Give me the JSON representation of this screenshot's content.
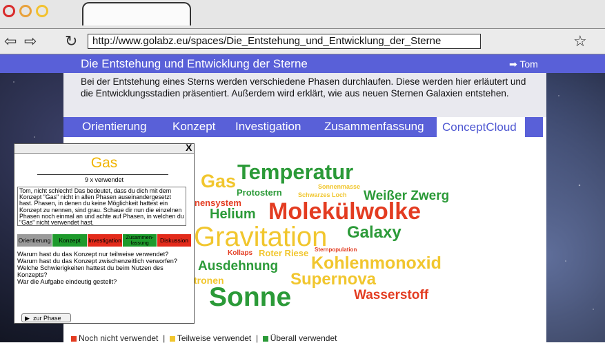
{
  "browser": {
    "url": "http://www.golabz.eu/spaces/Die_Entstehung_und_Entwicklung_der_Sterne"
  },
  "header": {
    "title": "Die Entstehung und Entwicklung der Sterne",
    "user": "Tom"
  },
  "intro": "Bei der Entstehung eines Sterns werden verschiedene Phasen durchlaufen. Diese werden hier erläutert und die Entwicklungsstadien präsentiert. Außerdem wird erklärt, wie aus neuen Sternen Galaxien entstehen.",
  "menu": {
    "items": [
      "Orientierung",
      "Konzept",
      "Investigation",
      "Zusammenfassung"
    ],
    "active": "ConceptCloud"
  },
  "cloud": {
    "words": [
      {
        "text": "Temperatur",
        "color": "#2b9a38"
      },
      {
        "text": "Gas",
        "color": "#f1c62e"
      },
      {
        "text": "Protostern",
        "color": "#2b9a38"
      },
      {
        "text": "Sonnenmasse",
        "color": "#f1c62e"
      },
      {
        "text": "Schwarzes Loch",
        "color": "#f1c62e"
      },
      {
        "text": "Weißer Zwerg",
        "color": "#2b9a38"
      },
      {
        "text": "nensystem",
        "color": "#e33c21"
      },
      {
        "text": "Helium",
        "color": "#2b9a38"
      },
      {
        "text": "Molekülwolke",
        "color": "#e33c21"
      },
      {
        "text": "Gravitation",
        "color": "#f1c62e"
      },
      {
        "text": "Galaxy",
        "color": "#2b9a38"
      },
      {
        "text": "Kollaps",
        "color": "#e33c21"
      },
      {
        "text": "Roter Riese",
        "color": "#f1c62e"
      },
      {
        "text": "Sternpopulation",
        "color": "#e33c21"
      },
      {
        "text": "Ausdehnung",
        "color": "#2b9a38"
      },
      {
        "text": "Kohlenmonoxid",
        "color": "#f1c62e"
      },
      {
        "text": "tronen",
        "color": "#f1c62e"
      },
      {
        "text": "Supernova",
        "color": "#f1c62e"
      },
      {
        "text": "Sonne",
        "color": "#2b9a38"
      },
      {
        "text": "Wasserstoff",
        "color": "#e33c21"
      }
    ]
  },
  "legend": {
    "not_used": "Noch nicht verwendet",
    "partially_used": "Teilweise verwendet",
    "everywhere_used": "Überall verwendet",
    "sep": "|",
    "colors": {
      "not_used": "#e33c21",
      "partially_used": "#f1c62e",
      "everywhere_used": "#2b9a38"
    }
  },
  "popup": {
    "close": "X",
    "title": "Gas",
    "usage": "9 x verwendet",
    "feedback": "Tom, nicht schlecht! Das bedeutet, dass du dich mit dem Konzept \"Gas\" nicht in allen Phasen auseinandergesetzt hast. Phasen, in denen du keine Möglichkeit hattest ein Konzept zu nennen, sind grau. Schaue dir nun die einzelnen Phasen noch einmal an und achte auf Phasen, in welchen du \"Gas\" nicht verwendet hast.",
    "phases": [
      {
        "label": "Orientierung",
        "color": "#9a9a9a"
      },
      {
        "label": "Konzept",
        "color": "#1e9a2c"
      },
      {
        "label": "Investigation",
        "color": "#e32b1b"
      },
      {
        "label": "Zusammen-\nfassung",
        "color": "#1e9a2c"
      },
      {
        "label": "Diskussion",
        "color": "#e32b1b"
      }
    ],
    "questions": [
      "Warum hast du das Konzept nur teilweise verwendet?",
      "Warum hast du das Konzept zwischenzeitlich verworfen?",
      "Welche Schwierigkeiten hattest du beim Nutzen des Konzepts?",
      "War die Aufgabe eindeutig gestellt?"
    ],
    "phase_button": "zur Phase"
  }
}
